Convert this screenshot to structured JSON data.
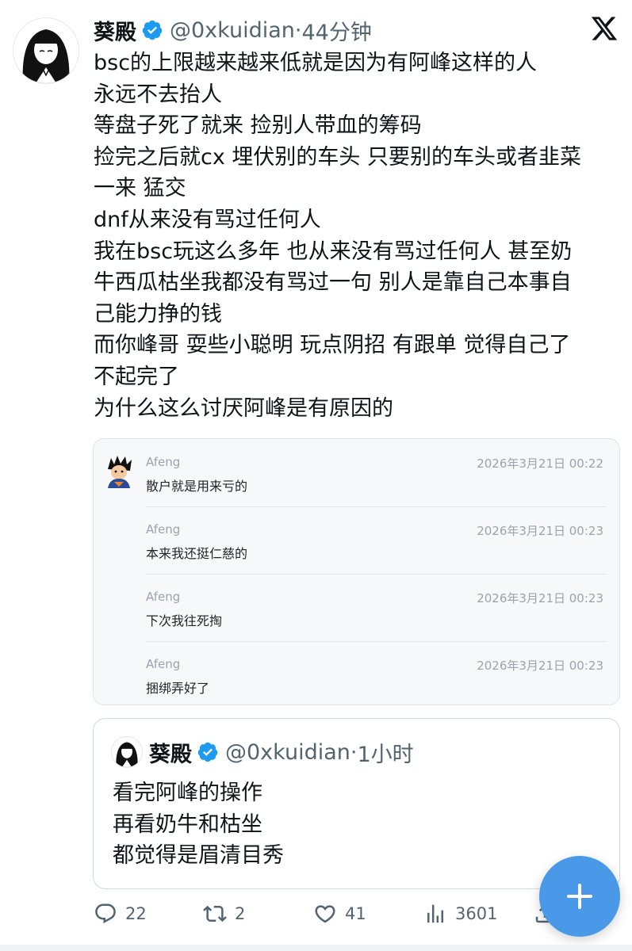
{
  "tweet": {
    "author_name": "葵殿",
    "handle": "@0xkuidian",
    "separator": "·",
    "time": "44分钟",
    "lines": [
      "bsc的上限越来越来低就是因为有阿峰这样的人",
      "永远不去抬人",
      "等盘子死了就来  捡别人带血的筹码",
      "捡完之后就cx 埋伏别的车头 只要别的车头或者韭菜",
      "一来 猛交",
      "dnf从来没有骂过任何人",
      "我在bsc玩这么多年 也从来没有骂过任何人 甚至奶",
      "牛西瓜枯坐我都没有骂过一句 别人是靠自己本事自",
      "己能力挣的钱",
      "而你峰哥 耍些小聪明 玩点阴招  有跟单 觉得自己了",
      "不起完了",
      "为什么这么讨厌阿峰是有原因的"
    ]
  },
  "chat_screenshot": {
    "messages": [
      {
        "sender": "Afeng",
        "time": "2026年3月21日 00:22",
        "text": "散户就是用来亏的"
      },
      {
        "sender": "Afeng",
        "time": "2026年3月21日 00:23",
        "text": "本来我还挺仁慈的"
      },
      {
        "sender": "Afeng",
        "time": "2026年3月21日 00:23",
        "text": "下次我往死掏"
      },
      {
        "sender": "Afeng",
        "time": "2026年3月21日 00:23",
        "text": "捆绑弄好了"
      }
    ]
  },
  "quoted_tweet": {
    "author_name": "葵殿",
    "handle": "@0xkuidian",
    "separator": "·",
    "time": "1小时",
    "lines": [
      "看完阿峰的操作",
      "再看奶牛和枯坐",
      "都觉得是眉清目秀"
    ]
  },
  "actions": {
    "replies": "22",
    "retweets": "2",
    "likes": "41",
    "views": "3601"
  },
  "icons": {
    "verified": "verified-badge-icon",
    "x_logo": "x-logo-icon",
    "compose": "plus-icon"
  },
  "colors": {
    "verified_blue": "#1d9bf0",
    "fab_blue": "#4a99e9",
    "muted_text": "#536471"
  }
}
